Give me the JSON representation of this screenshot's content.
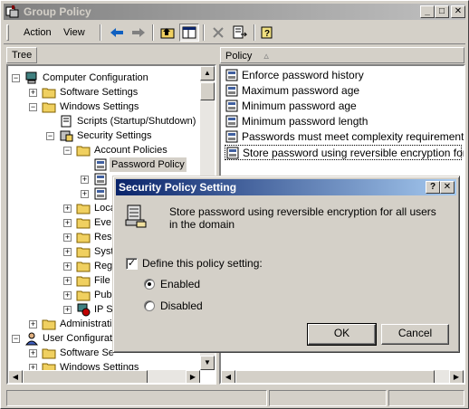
{
  "window": {
    "title": "Group Policy"
  },
  "menu": {
    "action": "Action",
    "view": "View"
  },
  "tree": {
    "header": "Tree",
    "items": [
      {
        "label": "Computer Configuration",
        "expander": "−"
      },
      {
        "label": "Software Settings",
        "expander": "+"
      },
      {
        "label": "Windows Settings",
        "expander": "−"
      },
      {
        "label": "Scripts (Startup/Shutdown)",
        "expander": ""
      },
      {
        "label": "Security Settings",
        "expander": "−"
      },
      {
        "label": "Account Policies",
        "expander": "−"
      },
      {
        "label": "Password Policy",
        "expander": ""
      },
      {
        "label": "",
        "expander": "+"
      },
      {
        "label": "",
        "expander": "+"
      },
      {
        "label": "Loca",
        "expander": "+"
      },
      {
        "label": "Eve",
        "expander": "+"
      },
      {
        "label": "Res",
        "expander": "+"
      },
      {
        "label": "Syst",
        "expander": "+"
      },
      {
        "label": "Reg",
        "expander": "+"
      },
      {
        "label": "File",
        "expander": "+"
      },
      {
        "label": "Pub",
        "expander": "+"
      },
      {
        "label": "IP S",
        "expander": "+"
      },
      {
        "label": "Administrati",
        "expander": "+"
      },
      {
        "label": "User Configurat",
        "expander": "−"
      },
      {
        "label": "Software Se",
        "expander": "+"
      },
      {
        "label": "Windows Settings",
        "expander": "+"
      }
    ]
  },
  "list": {
    "column_header": "Policy",
    "sort_indicator": "▵",
    "rows": [
      "Enforce password history",
      "Maximum password age",
      "Minimum password age",
      "Minimum password length",
      "Passwords must meet complexity requirements",
      "Store password using reversible encryption for all us"
    ]
  },
  "dialog": {
    "title": "Security Policy Setting",
    "help_glyph": "?",
    "close_glyph": "✕",
    "description": "Store password using reversible encryption for all users in the domain",
    "define_label": "Define this policy setting:",
    "define_checked": "✓",
    "enabled_label": "Enabled",
    "disabled_label": "Disabled",
    "ok_label": "OK",
    "cancel_label": "Cancel"
  },
  "caption": {
    "minimize": "_",
    "maximize": "□",
    "close": "✕"
  },
  "scroll": {
    "up": "▲",
    "down": "▼",
    "left": "◀",
    "right": "▶"
  }
}
